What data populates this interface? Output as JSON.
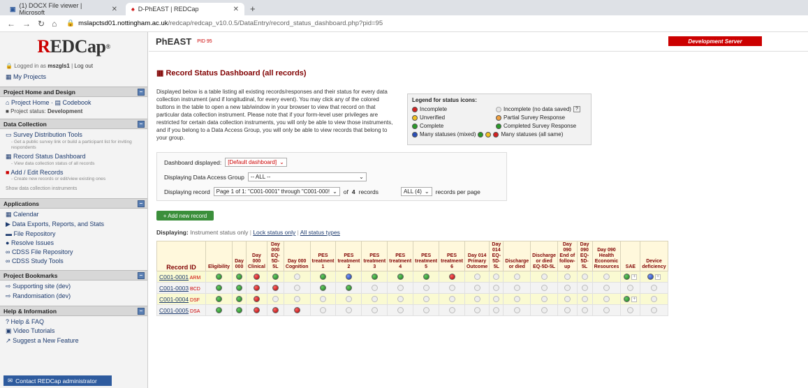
{
  "browser": {
    "tabs": [
      {
        "title": "(1) DOCX File viewer | Microsoft"
      },
      {
        "title": "D-PhEAST | REDCap"
      }
    ],
    "url_host": "mslapctsd01.nottingham.ac.uk",
    "url_path": "/redcap/redcap_v10.0.5/DataEntry/record_status_dashboard.php?pid=95"
  },
  "sidebar": {
    "logo": "REDCap",
    "logged_prefix": "Logged in as",
    "username": "mszgls1",
    "logout": "Log out",
    "my_projects": "My Projects",
    "sections": {
      "home": "Project Home and Design",
      "collection": "Data Collection",
      "apps": "Applications",
      "bookmarks": "Project Bookmarks",
      "help": "Help & Information"
    },
    "project_home": "Project Home",
    "codebook": "Codebook",
    "project_status_label": "Project status:",
    "project_status": "Development",
    "survey_tools": "Survey Distribution Tools",
    "survey_tools_sub": "- Get a public survey link or build a participant list for inviting respondents",
    "status_dashboard": "Record Status Dashboard",
    "status_dashboard_sub": "- View data collection status of all records",
    "add_edit": "Add / Edit Records",
    "add_edit_sub": "- Create new records or edit/view existing ones",
    "show_instruments": "Show data collection instruments",
    "apps": [
      "Calendar",
      "Data Exports, Reports, and Stats",
      "File Repository",
      "Resolve Issues",
      "CDSS File Repository",
      "CDSS Study Tools"
    ],
    "bookmarks": [
      "Supporting site (dev)",
      "Randomisation (dev)"
    ],
    "help": [
      "Help & FAQ",
      "Video Tutorials",
      "Suggest a New Feature"
    ],
    "contact": "Contact REDCap administrator"
  },
  "header": {
    "project": "PhEAST",
    "pid": "PID 95",
    "dev_server": "Development Server"
  },
  "page": {
    "title": "Record Status Dashboard (all records)",
    "description": "Displayed below is a table listing all existing records/responses and their status for every data collection instrument (and if longitudinal, for every event). You may click any of the colored buttons in the table to open a new tab/window in your browser to view that record on that particular data collection instrument. Please note that if your form-level user privileges are restricted for certain data collection instruments, you will only be able to view those instruments, and if you belong to a Data Access Group, you will only be able to view records that belong to your group."
  },
  "legend": {
    "title": "Legend for status icons:",
    "incomplete": "Incomplete",
    "incomplete_nodata": "Incomplete (no data saved)",
    "unverified": "Unverified",
    "partial": "Partial Survey Response",
    "complete": "Complete",
    "completed_survey": "Completed Survey Response",
    "many_mixed": "Many statuses (mixed)",
    "many_same": "Many statuses (all same)",
    "help_mark": "?"
  },
  "options": {
    "dashboard_label": "Dashboard displayed:",
    "dashboard_value": "[Default dashboard]",
    "dag_label": "Displaying Data Access Group",
    "dag_value": "-- ALL --",
    "record_label": "Displaying record",
    "record_value": "Page 1 of 1: \"C001-0001\" through \"C001-000!",
    "record_of": "of",
    "record_count": "4",
    "records_word": "records",
    "per_page_value": "ALL (4)",
    "per_page_label": "records per page"
  },
  "add_record": "+ Add new record",
  "displaying": {
    "label": "Displaying:",
    "current": "Instrument status only",
    "lock": "Lock status only",
    "all": "All status types",
    "sep": "|"
  },
  "table": {
    "record_id_header": "Record ID",
    "columns": [
      "Eligibility",
      "Day 000",
      "Day 000 Clinical",
      "Day 000 EQ-5D-5L",
      "Day 000 Cognition",
      "PES treatment 1",
      "PES treatment 2",
      "PES treatment 3",
      "PES treatment 4",
      "PES treatment 5",
      "PES treatment 6",
      "Day 014 Primary Outcome",
      "Day 014 EQ-5D-5L",
      "Discharge or died",
      "Discharge or died EQ-5D-5L",
      "Day 090 End of follow-up",
      "Day 090 EQ-5D-5L",
      "Day 090 Health Economic Resources",
      "SAE",
      "Device deficiency"
    ],
    "rows": [
      {
        "id": "C001-0001",
        "dag": "ARM",
        "status": [
          "green",
          "green",
          "red",
          "green",
          "gray",
          "green",
          "blue",
          "green",
          "green",
          "green",
          "red",
          "gray",
          "gray",
          "gray",
          "gray",
          "gray",
          "gray",
          "gray",
          "green+",
          "blue+"
        ]
      },
      {
        "id": "C001-0003",
        "dag": "BCD",
        "status": [
          "green",
          "green",
          "red",
          "red",
          "gray",
          "green",
          "green",
          "gray",
          "gray",
          "gray",
          "gray",
          "gray",
          "gray",
          "gray",
          "gray",
          "gray",
          "gray",
          "gray",
          "gray",
          "gray"
        ]
      },
      {
        "id": "C001-0004",
        "dag": "DSF",
        "status": [
          "green",
          "green",
          "red",
          "gray",
          "gray",
          "gray",
          "gray",
          "gray",
          "gray",
          "gray",
          "gray",
          "gray",
          "gray",
          "gray",
          "gray",
          "gray",
          "gray",
          "gray",
          "green+",
          "gray"
        ]
      },
      {
        "id": "C001-0005",
        "dag": "DSA",
        "status": [
          "green",
          "green",
          "red",
          "red",
          "red",
          "gray",
          "gray",
          "gray",
          "gray",
          "gray",
          "gray",
          "gray",
          "gray",
          "gray",
          "gray",
          "gray",
          "gray",
          "gray",
          "gray",
          "gray"
        ]
      }
    ]
  }
}
